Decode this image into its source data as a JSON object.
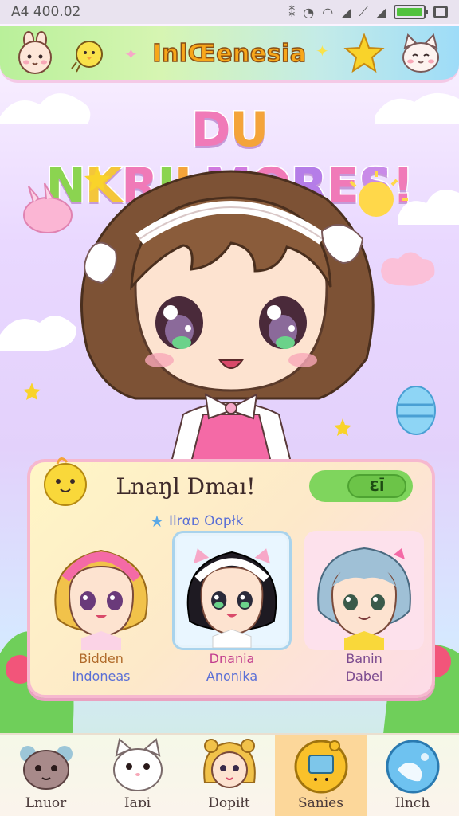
{
  "status_bar": {
    "time": "A4 400.02",
    "icons": [
      "nfc-icon",
      "alarm-icon",
      "wifi-icon",
      "signal-icon",
      "mute-icon",
      "signal-icon",
      "battery-icon",
      "screen-icon"
    ],
    "battery_level": 1.0
  },
  "header": {
    "title": "InlŒenesia",
    "left_icons": [
      "bunny-face-icon",
      "chick-icon",
      "sparkle-icon"
    ],
    "right_icons": [
      "sparkle-icon",
      "star-icon",
      "cat-face-icon"
    ]
  },
  "banner": {
    "letters": [
      {
        "ch": "D",
        "color": "#f07ab8"
      },
      {
        "ch": "U",
        "color": "#f4a43a"
      },
      {
        "ch": " ",
        "color": "#ffffff"
      },
      {
        "ch": "N",
        "color": "#8bd450"
      },
      {
        "ch": "K",
        "color": "#f4c63a"
      },
      {
        "ch": "R",
        "color": "#f07ab8"
      },
      {
        "ch": "I",
        "color": "#8bd450"
      },
      {
        "ch": "L",
        "color": "#f4a43a"
      },
      {
        "ch": "M",
        "color": "#d07ae0"
      },
      {
        "ch": "O",
        "color": "#f07ab8"
      },
      {
        "ch": "R",
        "color": "#b57de8"
      },
      {
        "ch": "E",
        "color": "#f07ab8"
      },
      {
        "ch": "S",
        "color": "#c98ae8"
      },
      {
        "ch": "!",
        "color": "#f07ab8"
      }
    ]
  },
  "roster": {
    "title": "Lnaŋl Dmaı!",
    "badge": "ƐĪ",
    "subtitle": "Ilrαɒ Oopłk",
    "characters": [
      {
        "name": "Bidden",
        "origin": "Indoneas",
        "name_color": "#b06a2a",
        "origin_color": "#5a6fd6",
        "selected": false
      },
      {
        "name": "Dnania",
        "origin": "Anonika",
        "name_color": "#c23c8e",
        "origin_color": "#5a6fd6",
        "selected": true
      },
      {
        "name": "Banin",
        "origin": "Dabel",
        "name_color": "#7b4a8f",
        "origin_color": "#7b4a8f",
        "selected": false
      }
    ]
  },
  "bottom_nav": {
    "items": [
      {
        "label": "Lnuor",
        "icon": "creature-icon",
        "active": false
      },
      {
        "label": "Iaɒi",
        "icon": "white-cat-icon",
        "active": false
      },
      {
        "label": "Dopiłt",
        "icon": "girl-doll-icon",
        "active": false
      },
      {
        "label": "Sanies",
        "icon": "book-gadget-icon",
        "active": true
      },
      {
        "label": "Ilnch",
        "icon": "globe-icon",
        "active": false
      }
    ]
  },
  "colors": {
    "header_title": "#f7a71a",
    "accent_pink": "#f6b8cf",
    "badge_green": "#6cc448",
    "active_tab": "#fcd79a"
  }
}
